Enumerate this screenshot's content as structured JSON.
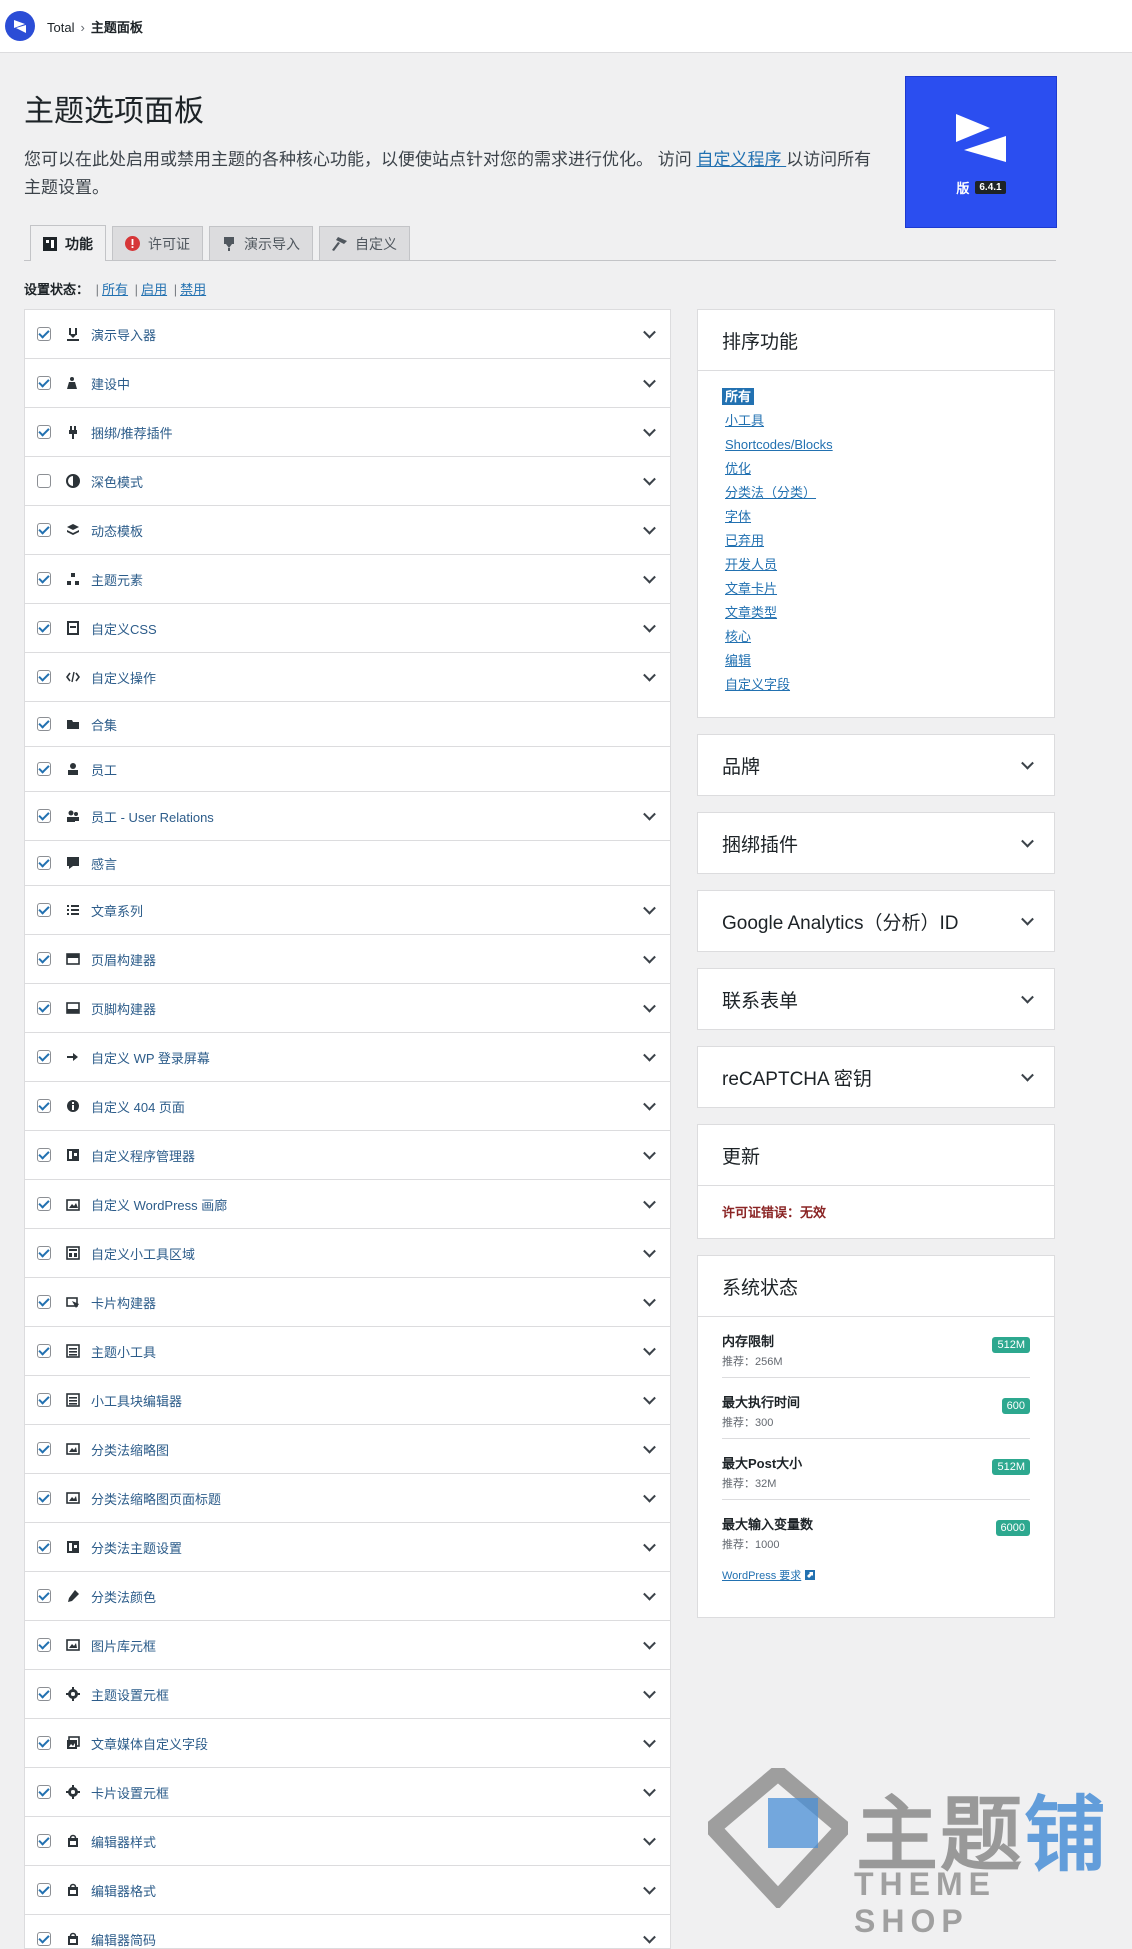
{
  "topbar": {
    "app": "Total",
    "current": "主题面板"
  },
  "header": {
    "title": "主题选项面板",
    "desc_before": "您可以在此处启用或禁用主题的各种核心功能，以便使站点针对您的需求进行优化。 访问 ",
    "desc_link": "自定义程序 ",
    "desc_after": "以访问所有主题设置。",
    "version_label": "版",
    "version": "6.4.1",
    "brand_color": "#2b4ef0"
  },
  "tabs": [
    {
      "label": "功能",
      "icon": "dashboard-icon"
    },
    {
      "label": "许可证",
      "icon": "warning-icon"
    },
    {
      "label": "演示导入",
      "icon": "download-icon"
    },
    {
      "label": "自定义",
      "icon": "hammer-icon"
    }
  ],
  "status": {
    "label": "设置状态：",
    "all": "所有",
    "enabled": "启用",
    "disabled": "禁用"
  },
  "modules": [
    {
      "label": "演示导入器",
      "checked": true,
      "expand": true,
      "icon": "download-icon"
    },
    {
      "label": "建设中",
      "checked": true,
      "expand": true,
      "icon": "construction-icon"
    },
    {
      "label": "捆绑/推荐插件",
      "checked": true,
      "expand": true,
      "icon": "plug-icon"
    },
    {
      "label": "深色模式",
      "checked": false,
      "expand": true,
      "icon": "contrast-icon"
    },
    {
      "label": "动态模板",
      "checked": true,
      "expand": true,
      "icon": "layers-icon"
    },
    {
      "label": "主题元素",
      "checked": true,
      "expand": true,
      "icon": "elements-icon"
    },
    {
      "label": "自定义CSS",
      "checked": true,
      "expand": true,
      "icon": "css-icon"
    },
    {
      "label": "自定义操作",
      "checked": true,
      "expand": true,
      "icon": "code-icon"
    },
    {
      "label": "合集",
      "checked": true,
      "expand": false,
      "icon": "folder-icon"
    },
    {
      "label": "员工",
      "checked": true,
      "expand": false,
      "icon": "staff-icon"
    },
    {
      "label": "员工 - User Relations",
      "checked": true,
      "expand": true,
      "icon": "users-icon"
    },
    {
      "label": "感言",
      "checked": true,
      "expand": false,
      "icon": "testimonial-icon"
    },
    {
      "label": "文章系列",
      "checked": true,
      "expand": true,
      "icon": "list-icon"
    },
    {
      "label": "页眉构建器",
      "checked": true,
      "expand": true,
      "icon": "header-icon"
    },
    {
      "label": "页脚构建器",
      "checked": true,
      "expand": true,
      "icon": "footer-icon"
    },
    {
      "label": "自定义 WP 登录屏幕",
      "checked": true,
      "expand": true,
      "icon": "login-icon"
    },
    {
      "label": "自定义 404 页面",
      "checked": true,
      "expand": true,
      "icon": "info-icon"
    },
    {
      "label": "自定义程序管理器",
      "checked": true,
      "expand": true,
      "icon": "customizer-icon"
    },
    {
      "label": "自定义 WordPress 画廊",
      "checked": true,
      "expand": true,
      "icon": "gallery-icon"
    },
    {
      "label": "自定义小工具区域",
      "checked": true,
      "expand": true,
      "icon": "widget-area-icon"
    },
    {
      "label": "卡片构建器",
      "checked": true,
      "expand": true,
      "icon": "card-icon"
    },
    {
      "label": "主题小工具",
      "checked": true,
      "expand": true,
      "icon": "widgets-icon"
    },
    {
      "label": "小工具块编辑器",
      "checked": true,
      "expand": true,
      "icon": "block-editor-icon"
    },
    {
      "label": "分类法缩略图",
      "checked": true,
      "expand": true,
      "icon": "image-icon"
    },
    {
      "label": "分类法缩略图页面标题",
      "checked": true,
      "expand": true,
      "icon": "image-icon"
    },
    {
      "label": "分类法主题设置",
      "checked": true,
      "expand": true,
      "icon": "customizer-icon"
    },
    {
      "label": "分类法颜色",
      "checked": true,
      "expand": true,
      "icon": "color-picker-icon"
    },
    {
      "label": "图片库元框",
      "checked": true,
      "expand": true,
      "icon": "image-icon"
    },
    {
      "label": "主题设置元框",
      "checked": true,
      "expand": true,
      "icon": "gear-icon"
    },
    {
      "label": "文章媒体自定义字段",
      "checked": true,
      "expand": true,
      "icon": "media-icon"
    },
    {
      "label": "卡片设置元框",
      "checked": true,
      "expand": true,
      "icon": "gear-icon"
    },
    {
      "label": "编辑器样式",
      "checked": true,
      "expand": true,
      "icon": "shop-icon"
    },
    {
      "label": "编辑器格式",
      "checked": true,
      "expand": true,
      "icon": "shop-icon"
    },
    {
      "label": "编辑器简码",
      "checked": true,
      "expand": true,
      "icon": "shop-icon"
    }
  ],
  "sidebar": {
    "sort": {
      "title": "排序功能",
      "items": [
        "所有",
        "小工具",
        "Shortcodes/Blocks",
        "优化",
        "分类法（分类）",
        "字体",
        "已弃用",
        "开发人员",
        "文章卡片",
        "文章类型",
        "核心",
        "编辑",
        "自定义字段"
      ]
    },
    "brand": "品牌",
    "bundled": "捆绑插件",
    "analytics": "Google Analytics（分析）ID",
    "contact": "联系表单",
    "recaptcha": "reCAPTCHA 密钥",
    "updates": {
      "title": "更新",
      "error": "许可证错误：无效"
    },
    "system": {
      "title": "系统状态",
      "rows": [
        {
          "name": "内存限制",
          "rec": "推荐：256M",
          "value": "512M"
        },
        {
          "name": "最大执行时间",
          "rec": "推荐：300",
          "value": "600"
        },
        {
          "name": "最大Post大小",
          "rec": "推荐：32M",
          "value": "512M"
        },
        {
          "name": "最大输入变量数",
          "rec": "推荐：1000",
          "value": "6000"
        }
      ],
      "link": "WordPress 要求"
    }
  },
  "watermark": {
    "text_gray": "主题",
    "text_blue": "铺",
    "sub": "THEME SHOP"
  }
}
